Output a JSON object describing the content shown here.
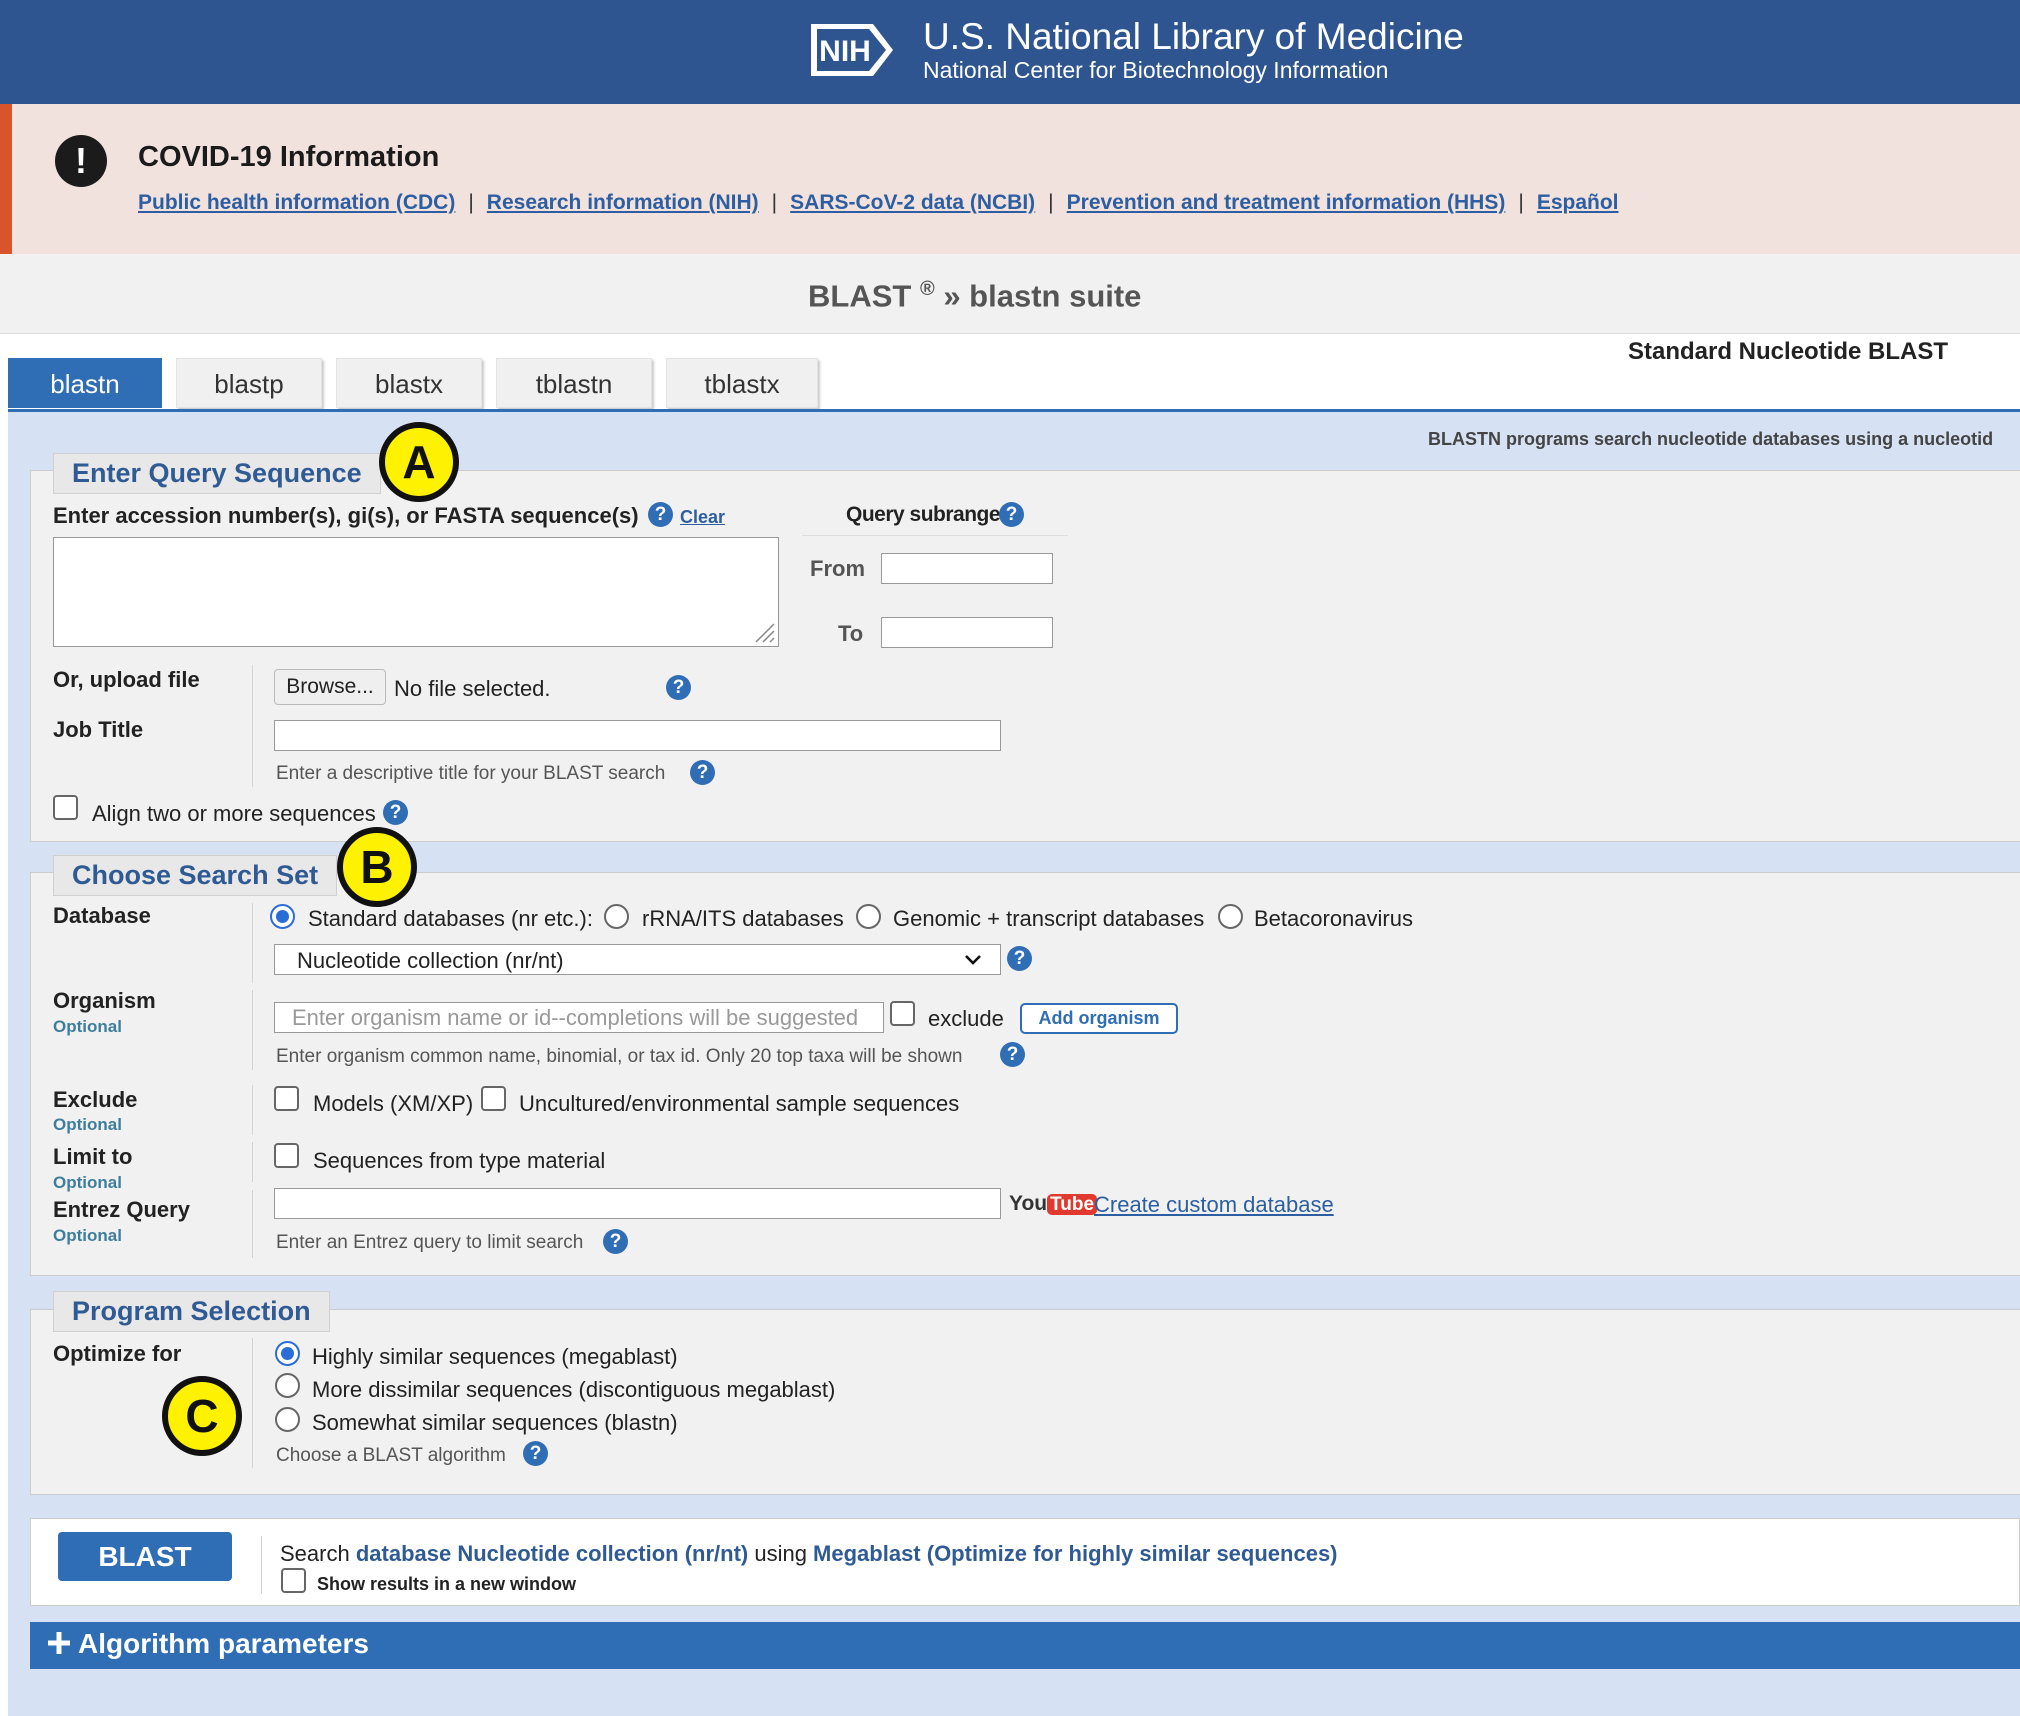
{
  "header": {
    "logo_text": "NIH",
    "title": "U.S. National Library of Medicine",
    "subtitle": "National Center for Biotechnology Information"
  },
  "covid": {
    "icon": "exclamation-icon",
    "title": "COVID-19 Information",
    "links": [
      "Public health information (CDC)",
      "Research information (NIH)",
      "SARS-CoV-2 data (NCBI)",
      "Prevention and treatment information (HHS)",
      "Español"
    ],
    "separator": "|"
  },
  "page": {
    "title_blast": "BLAST",
    "title_reg": "®",
    "title_rest": " » blastn suite"
  },
  "tabs": [
    "blastn",
    "blastp",
    "blastx",
    "tblastn",
    "tblastx"
  ],
  "standard_label": "Standard Nucleotide BLAST",
  "program_description": "BLASTN programs search nucleotide databases using a nucleotid",
  "query": {
    "legend": "Enter Query Sequence",
    "accession_label": "Enter accession number(s), gi(s), or FASTA sequence(s)",
    "clear_label": "Clear",
    "sequence_value": "",
    "subrange_label": "Query subrange",
    "from_label": "From",
    "to_label": "To",
    "from_value": "",
    "to_value": "",
    "upload_label": "Or, upload file",
    "browse_label": "Browse...",
    "no_file": "No file selected.",
    "job_title_label": "Job Title",
    "job_title_value": "",
    "job_title_hint": "Enter a descriptive title for your BLAST search",
    "align_label": "Align two or more sequences"
  },
  "search_set": {
    "legend": "Choose Search Set",
    "database_label": "Database",
    "db_options": [
      "Standard databases (nr etc.):",
      "rRNA/ITS databases",
      "Genomic + transcript databases",
      "Betacoronavirus"
    ],
    "db_selected": "Nucleotide collection (nr/nt)",
    "organism_label": "Organism",
    "optional": "Optional",
    "organism_placeholder": "Enter organism name or id--completions will be suggested",
    "exclude_chk_label": "exclude",
    "add_organism": "Add organism",
    "organism_hint": "Enter organism common name, binomial, or tax id. Only 20 top taxa will be shown",
    "exclude_label": "Exclude",
    "models_label": "Models (XM/XP)",
    "uncultured_label": "Uncultured/environmental sample sequences",
    "limit_label": "Limit to",
    "type_material_label": "Sequences from type material",
    "entrez_label": "Entrez Query",
    "entrez_value": "",
    "youtube_you": "You",
    "youtube_tube": "Tube",
    "custom_db_link": "Create custom database",
    "entrez_hint": "Enter an Entrez query to limit search"
  },
  "program": {
    "legend": "Program Selection",
    "optimize_label": "Optimize for",
    "options": [
      "Highly similar sequences (megablast)",
      "More dissimilar sequences (discontiguous megablast)",
      "Somewhat similar sequences (blastn)"
    ],
    "hint": "Choose a BLAST algorithm"
  },
  "submit": {
    "button": "BLAST",
    "search_prefix": "Search ",
    "search_db": "database Nucleotide collection (nr/nt)",
    "search_using": " using ",
    "search_algo": "Megablast (Optimize for highly similar sequences)",
    "new_window": "Show results in a new window"
  },
  "algorithm_params": {
    "icon": "plus-icon",
    "label": "Algorithm parameters"
  },
  "callouts": [
    "A",
    "B",
    "C"
  ],
  "help_glyph": "?",
  "colors": {
    "header_blue": "#2f5590",
    "tab_blue": "#2f6db5",
    "covid_bg": "#f2e2dd",
    "callout_yellow": "#fff200"
  }
}
